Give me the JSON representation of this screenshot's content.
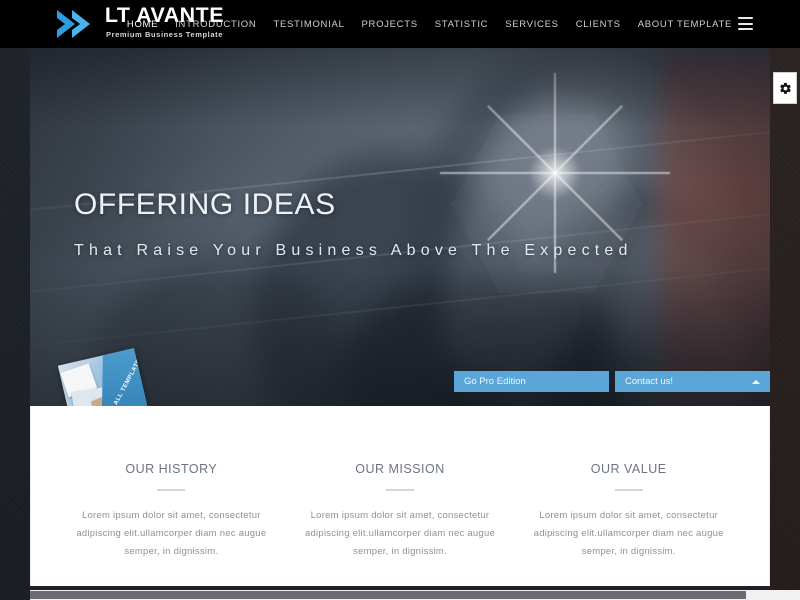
{
  "header": {
    "logo": {
      "name": "LT AVANTE",
      "tagline": "Premium Business Template",
      "chevron_icon": "double-chevron-right-icon"
    },
    "nav_items": [
      {
        "label": "HOME"
      },
      {
        "label": "INTRODUCTION"
      },
      {
        "label": "TESTIMONIAL"
      },
      {
        "label": "PROJECTS"
      },
      {
        "label": "STATISTIC"
      },
      {
        "label": "SERVICES"
      },
      {
        "label": "CLIENTS"
      },
      {
        "label": "ABOUT TEMPLATE"
      }
    ],
    "menu_toggle_icon": "hamburger-menu-icon",
    "background_color": "#000000",
    "accent_color": "#2f9ee0"
  },
  "hero": {
    "title": "OFFERING IDEAS",
    "subtitle": "That Raise Your Business Above The Expected",
    "promo_card": {
      "label": "SEE ALL TEMPLATES"
    },
    "buttons": [
      {
        "label": "Go Pro Edition",
        "name": "go-pro-edition-button"
      },
      {
        "label": "Contact us!",
        "name": "contact-us-button",
        "icon": "chevron-up-icon"
      }
    ],
    "button_color": "#5ba6d8"
  },
  "settings_tab": {
    "icon": "gear-icon"
  },
  "content": {
    "columns": [
      {
        "heading": "OUR HISTORY",
        "body": "Lorem ipsum dolor sit amet, consectetur adipiscing elit.ullamcorper diam nec augue semper, in dignissim."
      },
      {
        "heading": "OUR MISSION",
        "body": "Lorem ipsum dolor sit amet, consectetur adipiscing elit.ullamcorper diam nec augue semper, in dignissim."
      },
      {
        "heading": "OUR VALUE",
        "body": "Lorem ipsum dolor sit amet, consectetur adipiscing elit.ullamcorper diam nec augue semper, in dignissim."
      }
    ]
  }
}
